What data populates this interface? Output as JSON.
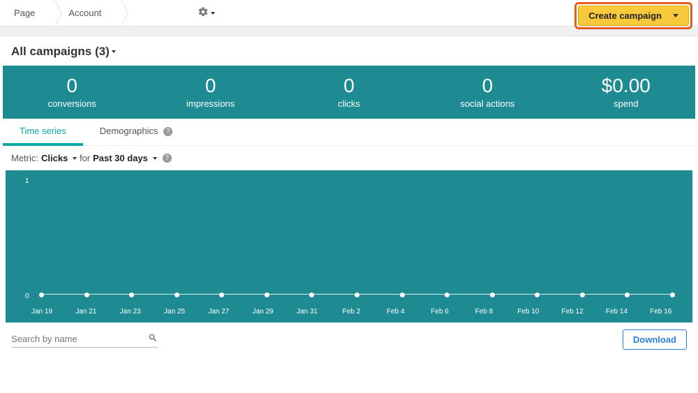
{
  "topnav": {
    "crumb1": "Page",
    "crumb2": "Account",
    "create_label": "Create campaign"
  },
  "title": "All campaigns (3)",
  "metrics": [
    {
      "value": "0",
      "label": "conversions"
    },
    {
      "value": "0",
      "label": "impressions"
    },
    {
      "value": "0",
      "label": "clicks"
    },
    {
      "value": "0",
      "label": "social actions"
    },
    {
      "value": "$0.00",
      "label": "spend"
    }
  ],
  "tabs": {
    "time_series": "Time series",
    "demographics": "Demographics"
  },
  "selector": {
    "metric_label": "Metric:",
    "metric_value": "Clicks",
    "for_label": "for",
    "range_value": "Past 30 days"
  },
  "chart_data": {
    "type": "line",
    "title": "",
    "xlabel": "",
    "ylabel": "",
    "ylim": [
      0,
      1
    ],
    "y_ticks": [
      "1",
      "0"
    ],
    "categories": [
      "Jan 19",
      "Jan 21",
      "Jan 23",
      "Jan 25",
      "Jan 27",
      "Jan 29",
      "Jan 31",
      "Feb 2",
      "Feb 4",
      "Feb 6",
      "Feb 8",
      "Feb 10",
      "Feb 12",
      "Feb 14",
      "Feb 16"
    ],
    "values": [
      0,
      0,
      0,
      0,
      0,
      0,
      0,
      0,
      0,
      0,
      0,
      0,
      0,
      0,
      0
    ]
  },
  "search": {
    "placeholder": "Search by name"
  },
  "download_label": "Download"
}
